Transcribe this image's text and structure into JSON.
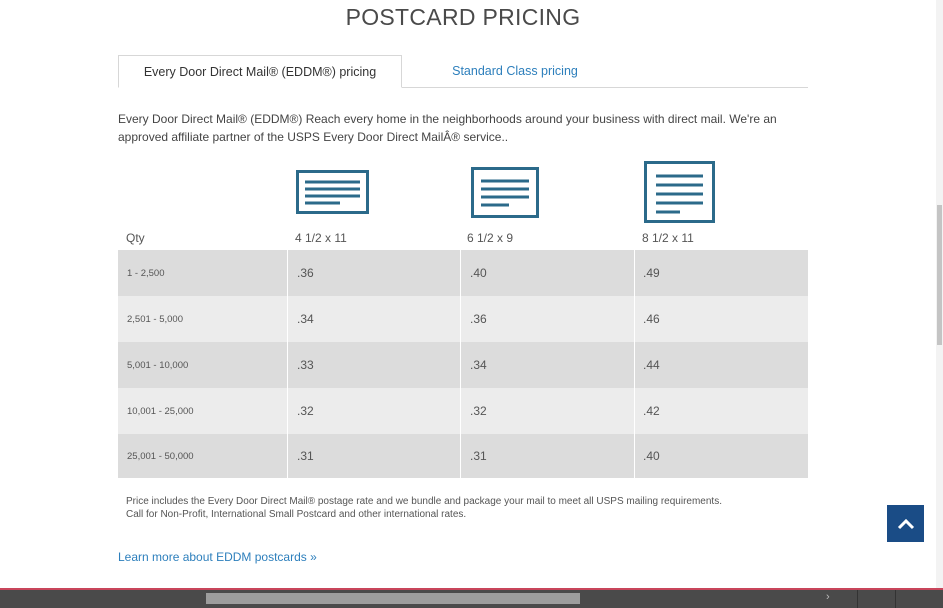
{
  "page": {
    "title": "POSTCARD PRICING"
  },
  "tabs": [
    {
      "label": "Every Door Direct Mail® (EDDM®) pricing",
      "active": true
    },
    {
      "label": "Standard Class pricing",
      "active": false
    }
  ],
  "intro": "Every Door Direct Mail® (EDDM®) Reach every home in the neighborhoods around your business with direct mail. We're an approved affiliate partner of the USPS Every Door Direct MailÂ® service..",
  "pricing": {
    "qty_header": "Qty",
    "columns": [
      "4 1/2 x 11",
      "6 1/2 x 9",
      "8 1/2 x 11"
    ],
    "column_icons": [
      "postcard-small-icon",
      "postcard-medium-icon",
      "postcard-large-icon"
    ],
    "rows": [
      {
        "qty": "1 - 2,500",
        "prices": [
          ".36",
          ".40",
          ".49"
        ]
      },
      {
        "qty": "2,501 - 5,000",
        "prices": [
          ".34",
          ".36",
          ".46"
        ]
      },
      {
        "qty": "5,001 - 10,000",
        "prices": [
          ".33",
          ".34",
          ".44"
        ]
      },
      {
        "qty": "10,001 - 25,000",
        "prices": [
          ".32",
          ".32",
          ".42"
        ]
      },
      {
        "qty": "25,001 - 50,000",
        "prices": [
          ".31",
          ".31",
          ".40"
        ]
      }
    ]
  },
  "note": {
    "line1": "Price includes the Every Door Direct Mail® postage rate and we bundle and package your mail to meet all USPS mailing requirements.",
    "line2": "Call for Non-Profit, International Small Postcard and other international rates."
  },
  "links": {
    "learn_more": "Learn more about EDDM postcards »"
  },
  "colors": {
    "accent": "#2d7fbc",
    "icon": "#2b6a8a",
    "back_to_top": "#1a4c86"
  },
  "icons": {
    "back_to_top": "chevron-up-icon"
  }
}
